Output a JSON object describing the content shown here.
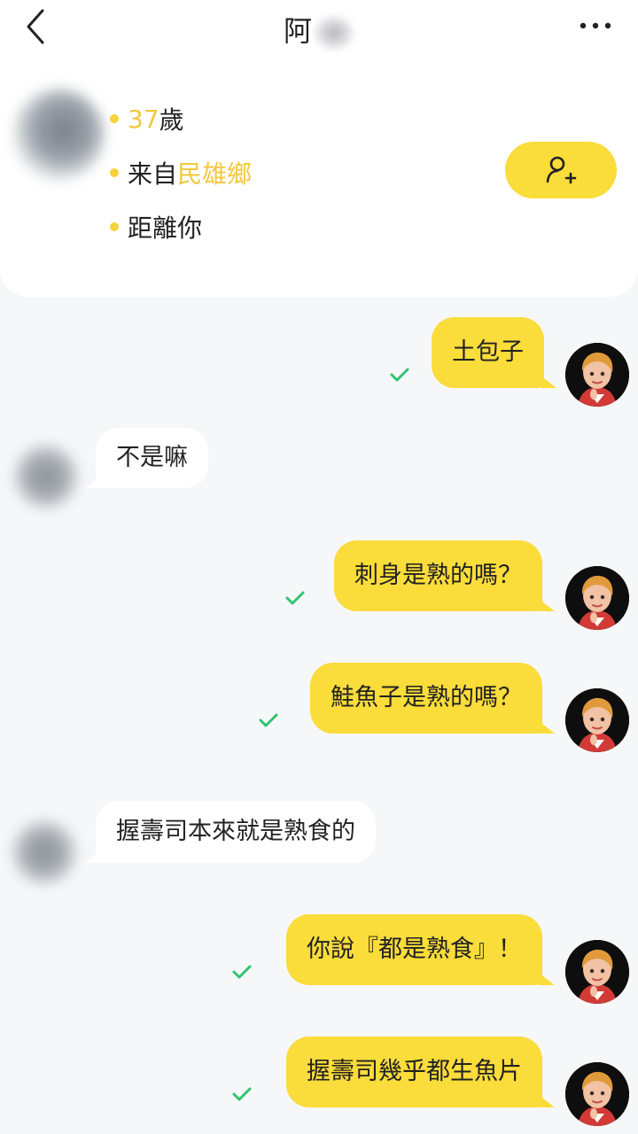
{
  "header": {
    "back_icon": "chevron-left-icon",
    "title": "阿",
    "more_icon": "more-horizontal-icon"
  },
  "profile": {
    "age_value": "37",
    "age_unit": "歲",
    "from_prefix": "来自",
    "from_place": "民雄鄉",
    "distance_label": "距離你",
    "follow_icon": "add-friend-icon"
  },
  "messages": [
    {
      "dir": "out",
      "text": "土包子",
      "read": true
    },
    {
      "dir": "in",
      "text": "不是嘛"
    },
    {
      "dir": "out",
      "text": "刺身是熟的嗎？",
      "read": true
    },
    {
      "dir": "out",
      "text": "鮭魚子是熟的嗎？",
      "read": true
    },
    {
      "dir": "in",
      "text": "握壽司本來就是熟食的"
    },
    {
      "dir": "out",
      "text": "你說『都是熟食』！",
      "read": true
    },
    {
      "dir": "out",
      "text": "握壽司幾乎都生魚片",
      "read": true
    }
  ],
  "colors": {
    "accent": "#fadc3a",
    "highlight_text": "#f2c83c",
    "read_check": "#2fc46e",
    "background": "#f6f7f9"
  }
}
